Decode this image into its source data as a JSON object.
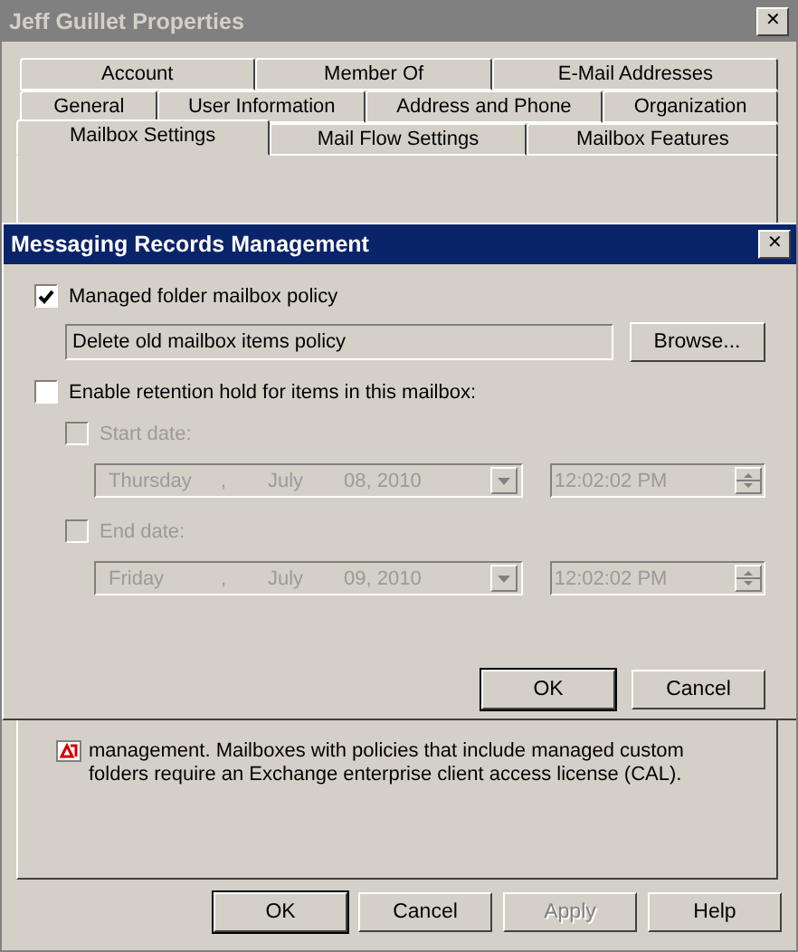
{
  "window": {
    "title": "Jeff Guillet Properties",
    "close": "✕"
  },
  "tab_rows": [
    [
      {
        "label": "Account",
        "selected": false
      },
      {
        "label": "Member Of",
        "selected": false
      },
      {
        "label": "E-Mail Addresses",
        "selected": false
      }
    ],
    [
      {
        "label": "General",
        "selected": false
      },
      {
        "label": "User Information",
        "selected": false
      },
      {
        "label": "Address and Phone",
        "selected": false
      },
      {
        "label": "Organization",
        "selected": false
      }
    ],
    [
      {
        "label": "Mailbox Settings",
        "selected": true
      },
      {
        "label": "Mail Flow Settings",
        "selected": false
      },
      {
        "label": "Mailbox Features",
        "selected": false
      }
    ]
  ],
  "note": {
    "text": "management. Mailboxes with policies that include managed custom folders require an Exchange enterprise client access license (CAL)."
  },
  "buttons": [
    {
      "label": "OK",
      "disabled": false
    },
    {
      "label": "Cancel",
      "disabled": false
    },
    {
      "label": "Apply",
      "disabled": true
    },
    {
      "label": "Help",
      "disabled": false
    }
  ],
  "dialog": {
    "title": "Messaging Records Management",
    "close": "✕",
    "policy": {
      "label": "Managed folder mailbox policy",
      "checked": true,
      "value": "Delete old mailbox items policy",
      "browse": "Browse..."
    },
    "hold": {
      "label": "Enable retention hold for items in this  mailbox:",
      "checked": false
    },
    "dates": [
      {
        "label": "Start date:",
        "checked": false,
        "disabled": true,
        "date_parts": [
          "Thursday",
          ",",
          "July",
          "08, 2010"
        ],
        "time": "12:02:02 PM"
      },
      {
        "label": "End date:",
        "checked": false,
        "disabled": true,
        "date_parts": [
          "Friday",
          ",",
          "July",
          "09, 2010"
        ],
        "time": "12:02:02 PM"
      }
    ],
    "buttons": [
      {
        "label": "OK"
      },
      {
        "label": "Cancel"
      }
    ]
  }
}
